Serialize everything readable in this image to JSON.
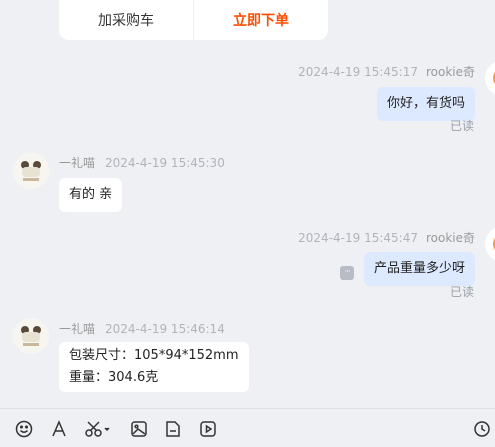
{
  "product_card": {
    "add_cart_label": "加采购车",
    "buy_now_label": "立即下单"
  },
  "messages": [
    {
      "side": "right",
      "time": "2024-4-19 15:45:17",
      "sender": "rookie奇",
      "text": "你好，有货吗",
      "status": "已读"
    },
    {
      "side": "left",
      "time": "2024-4-19 15:45:30",
      "sender": "一礼喵",
      "text": "有的 亲"
    },
    {
      "side": "right",
      "time": "2024-4-19 15:45:47",
      "sender": "rookie奇",
      "text": "产品重量多少呀",
      "status": "已读"
    },
    {
      "side": "left",
      "time": "2024-4-19 15:46:14",
      "sender": "一礼喵",
      "lines": [
        "包装尺寸：105*94*152mm",
        "重量：304.6克"
      ]
    }
  ],
  "toolbar": {
    "icons": [
      "emoji-icon",
      "font-icon",
      "scissors-icon",
      "image-icon",
      "file-icon",
      "video-icon",
      "history-icon"
    ]
  },
  "colors": {
    "background": "#eff0f4",
    "my_bubble": "#dce9ff",
    "their_bubble": "#ffffff",
    "buy_accent": "#ff4d00"
  }
}
